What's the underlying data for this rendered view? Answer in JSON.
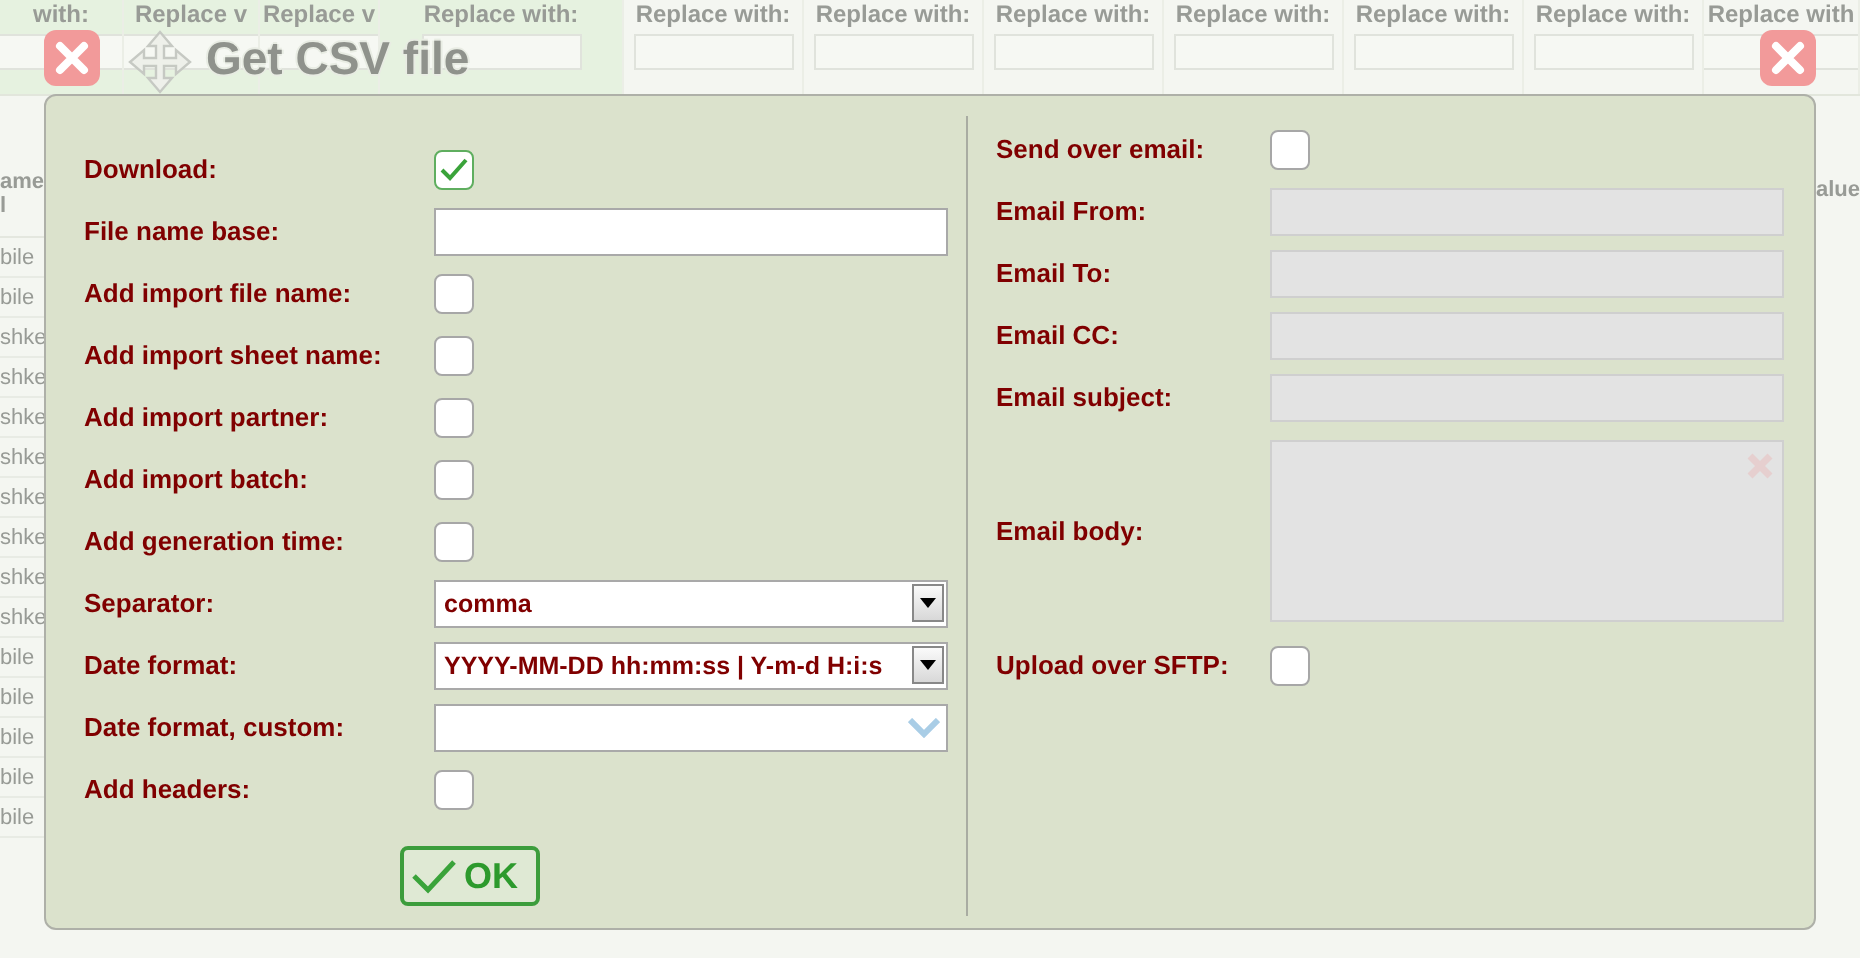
{
  "background": {
    "header_columns": [
      {
        "label": "with:",
        "highlighted": true
      },
      {
        "label": "Replace v",
        "highlighted": true
      },
      {
        "label": "Replace v",
        "highlighted": true
      },
      {
        "label": "Replace with:",
        "highlighted": true
      },
      {
        "label": "Replace with:",
        "highlighted": false
      },
      {
        "label": "Replace with:",
        "highlighted": false
      },
      {
        "label": "Replace with:",
        "highlighted": false
      },
      {
        "label": "Replace with:",
        "highlighted": false
      },
      {
        "label": "Replace with:",
        "highlighted": false
      },
      {
        "label": "Replace with:",
        "highlighted": false
      },
      {
        "label": "Replace with",
        "highlighted": false
      }
    ],
    "left_column": {
      "header": [
        "ame",
        "l"
      ],
      "cells": [
        "bile",
        "bile",
        "shke",
        "shke",
        "shke",
        "shke",
        "shke",
        "shke",
        "shke",
        "shke",
        "bile",
        "bile",
        "bile",
        "bile",
        "bile"
      ]
    },
    "right_column": {
      "header": "alue"
    }
  },
  "dialog": {
    "title": "Get CSV file",
    "left_fields": [
      {
        "kind": "checkbox",
        "label": "Download:",
        "checked": true
      },
      {
        "kind": "text",
        "label": "File name base:",
        "disabled": false
      },
      {
        "kind": "checkbox",
        "label": "Add import file name:",
        "checked": false
      },
      {
        "kind": "checkbox",
        "label": "Add import sheet name:",
        "checked": false
      },
      {
        "kind": "checkbox",
        "label": "Add import partner:",
        "checked": false
      },
      {
        "kind": "checkbox",
        "label": "Add import batch:",
        "checked": false
      },
      {
        "kind": "checkbox",
        "label": "Add generation time:",
        "checked": false
      },
      {
        "kind": "select",
        "label": "Separator:",
        "value": "comma"
      },
      {
        "kind": "select",
        "label": "Date format:",
        "value": "YYYY-MM-DD hh:mm:ss | Y-m-d H:i:s"
      },
      {
        "kind": "combo",
        "label": "Date format, custom:"
      },
      {
        "kind": "checkbox",
        "label": "Add headers:",
        "checked": false
      }
    ],
    "ok_button": "OK",
    "right_fields": [
      {
        "kind": "checkbox",
        "label": "Send over email:",
        "checked": false
      },
      {
        "kind": "text",
        "label": "Email From:",
        "disabled": true
      },
      {
        "kind": "text",
        "label": "Email To:",
        "disabled": true
      },
      {
        "kind": "text",
        "label": "Email CC:",
        "disabled": true
      },
      {
        "kind": "text",
        "label": "Email subject:",
        "disabled": true
      },
      {
        "kind": "textarea",
        "label": "Email body:",
        "disabled": true
      },
      {
        "kind": "checkbox",
        "label": "Upload over SFTP:",
        "checked": false
      }
    ]
  }
}
